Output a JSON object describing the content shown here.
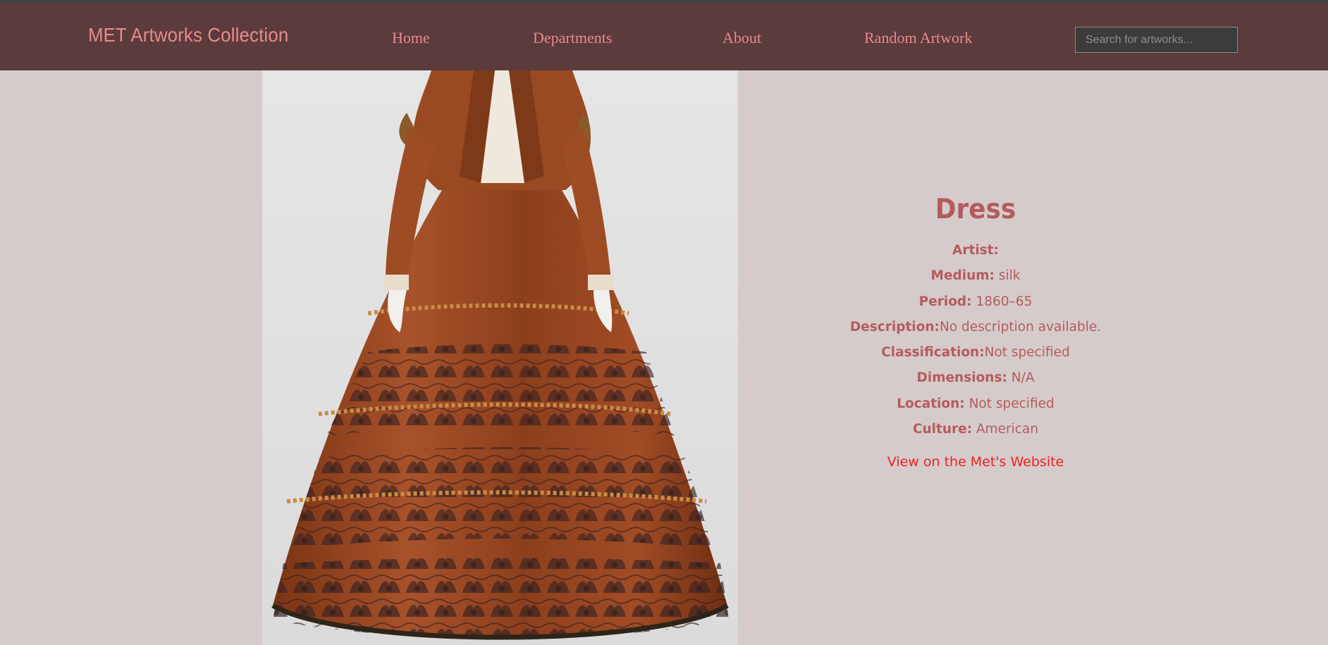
{
  "header": {
    "brand": "MET Artworks Collection",
    "nav": {
      "home": "Home",
      "departments": "Departments",
      "about": "About",
      "random": "Random Artwork"
    },
    "search": {
      "placeholder": "Search for artworks...",
      "value": ""
    }
  },
  "artwork": {
    "image_alt": "Dress",
    "title": "Dress",
    "fields": {
      "artist": {
        "label": "Artist:",
        "value": ""
      },
      "medium": {
        "label": "Medium:",
        "value": "silk"
      },
      "period": {
        "label": "Period:",
        "value": "1860–65"
      },
      "description": {
        "label": "Description:",
        "value": "No description available."
      },
      "classification": {
        "label": "Classification:",
        "value": "Not specified"
      },
      "dimensions": {
        "label": "Dimensions:",
        "value": "N/A"
      },
      "location": {
        "label": "Location:",
        "value": "Not specified"
      },
      "culture": {
        "label": "Culture:",
        "value": "American"
      }
    },
    "met_link": "View on the Met's Website"
  },
  "colors": {
    "header_bg": "#5c3b3c",
    "page_bg": "#d5cbcb",
    "accent_text": "#e88a8a",
    "detail_text": "#b55b5d",
    "link": "#ee2222"
  }
}
